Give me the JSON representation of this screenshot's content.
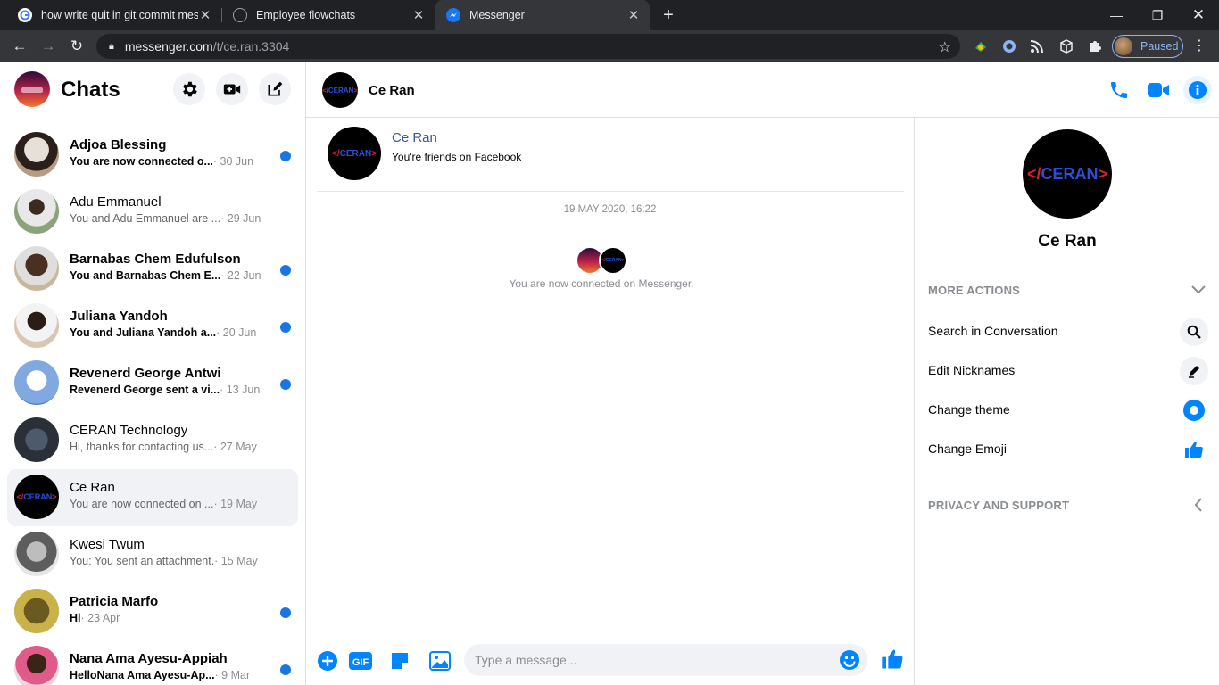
{
  "browser": {
    "tabs": [
      {
        "title": "how write quit in git commit mes",
        "favicon": "google-icon"
      },
      {
        "title": "Employee flowchats",
        "favicon": "globe-icon"
      },
      {
        "title": "Messenger",
        "favicon": "messenger-icon"
      }
    ],
    "url_host": "messenger.com",
    "url_path": "/t/ce.ran.3304",
    "profile_label": "Paused"
  },
  "sidebar": {
    "title": "Chats",
    "conversations": [
      {
        "name": "Adjoa Blessing",
        "preview": "You are now connected o...",
        "date": " · 30 Jun",
        "unread": true
      },
      {
        "name": "Adu Emmanuel",
        "preview": "You and Adu Emmanuel are ...",
        "date": " · 29 Jun",
        "unread": false
      },
      {
        "name": "Barnabas Chem Edufulson",
        "preview": "You and Barnabas Chem E...",
        "date": " · 22 Jun",
        "unread": true
      },
      {
        "name": "Juliana Yandoh",
        "preview": "You and Juliana Yandoh a...",
        "date": " · 20 Jun",
        "unread": true
      },
      {
        "name": "Revenerd George Antwi",
        "preview": "Revenerd George sent a vi...",
        "date": " · 13 Jun",
        "unread": true
      },
      {
        "name": "CERAN Technology",
        "preview": "Hi, thanks for contacting us...",
        "date": " · 27 May",
        "unread": false
      },
      {
        "name": "Ce Ran",
        "preview": "You are now connected on ...",
        "date": " · 19 May",
        "unread": false,
        "selected": true
      },
      {
        "name": "Kwesi Twum",
        "preview": "You: You sent an attachment.",
        "date": " · 15 May",
        "unread": false
      },
      {
        "name": "Patricia Marfo",
        "preview": "Hi",
        "date": " · 23 Apr",
        "unread": true
      },
      {
        "name": "Nana Ama Ayesu-Appiah",
        "preview": "HelloNana Ama Ayesu-Ap...",
        "date": " · 9 Mar",
        "unread": true
      }
    ]
  },
  "conversation": {
    "name": "Ce Ran",
    "intro_name": "Ce Ran",
    "intro_subtitle": "You're friends on Facebook",
    "timestamp": "19 MAY 2020, 16:22",
    "system_message": "You are now connected on Messenger.",
    "composer_placeholder": "Type a message..."
  },
  "details": {
    "name": "Ce Ran",
    "more_actions_header": "MORE ACTIONS",
    "actions": [
      {
        "label": "Search in Conversation",
        "icon": "search-icon"
      },
      {
        "label": "Edit Nicknames",
        "icon": "pencil-icon"
      },
      {
        "label": "Change theme",
        "icon": "theme-icon"
      },
      {
        "label": "Change Emoji",
        "icon": "thumbs-up-icon"
      }
    ],
    "privacy_header": "PRIVACY AND SUPPORT"
  },
  "logo_text": {
    "open": "</",
    "name": "CERAN",
    "close": ">"
  },
  "colors": {
    "accent": "#0084ff",
    "unread_dot": "#1b74e4",
    "selected_bg": "#f0f2f5"
  }
}
